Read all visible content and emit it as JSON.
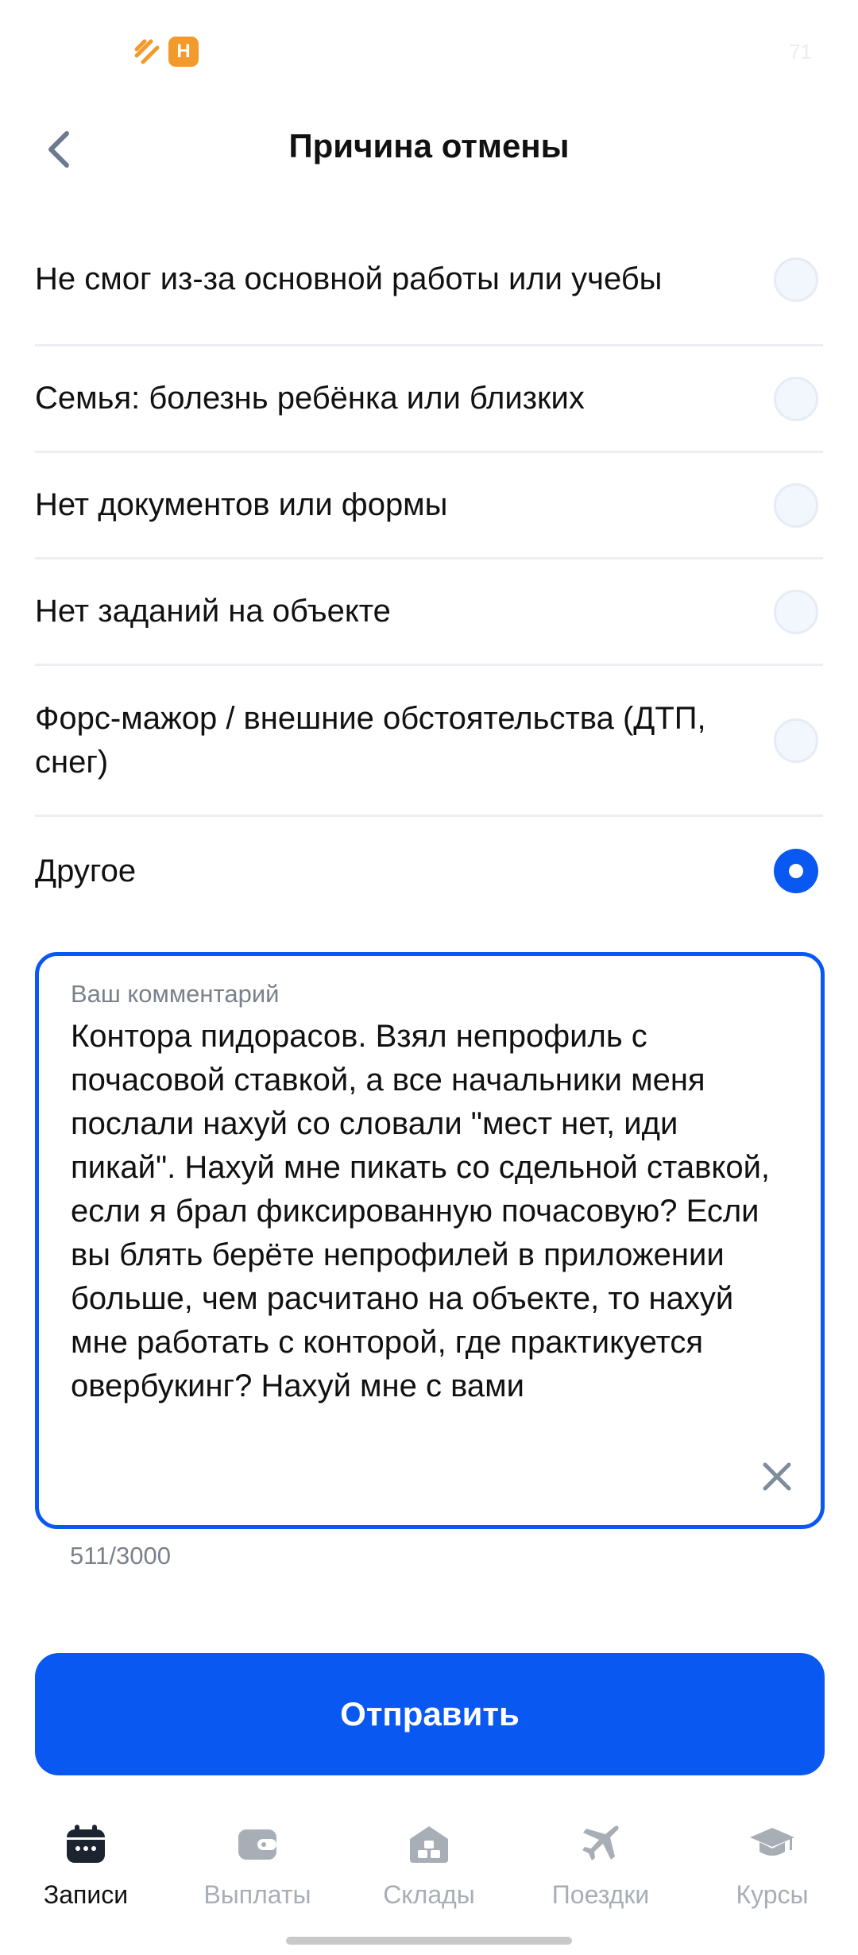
{
  "status_bar": {
    "right_text": "71",
    "app_badge": "H"
  },
  "header": {
    "title": "Причина отмены"
  },
  "reasons": [
    {
      "label": "Не смог из-за основной работы или учебы",
      "selected": false
    },
    {
      "label": "Семья: болезнь ребёнка или близких",
      "selected": false
    },
    {
      "label": "Нет документов или формы",
      "selected": false
    },
    {
      "label": "Нет заданий на объекте",
      "selected": false
    },
    {
      "label": "Форс-мажор / внешние обстоятельства (ДТП, снег)",
      "selected": false
    },
    {
      "label": "Другое",
      "selected": true
    }
  ],
  "comment": {
    "label": "Ваш комментарий",
    "value": "Контора пидорасов. Взял непрофиль с почасовой ставкой, а все начальники меня послали нахуй со словали \"мест нет, иди пикай\". Нахуй мне пикать со сдельной ставкой, если я брал фиксированную почасовую? Если вы блять берёте непрофилей в приложении больше, чем расчитано на объекте, то нахуй мне работать с конторой, где практикуется овербукинг? Нахуй мне с вами",
    "counter": "511/3000"
  },
  "submit": {
    "label": "Отправить"
  },
  "nav": {
    "items": [
      {
        "label": "Записи",
        "icon": "calendar-icon",
        "active": true
      },
      {
        "label": "Выплаты",
        "icon": "wallet-icon",
        "active": false
      },
      {
        "label": "Склады",
        "icon": "warehouse-icon",
        "active": false
      },
      {
        "label": "Поездки",
        "icon": "airplane-icon",
        "active": false
      },
      {
        "label": "Курсы",
        "icon": "graduation-cap-icon",
        "active": false
      }
    ]
  },
  "colors": {
    "accent": "#0a58f2",
    "inactive": "#a8aeb6"
  }
}
